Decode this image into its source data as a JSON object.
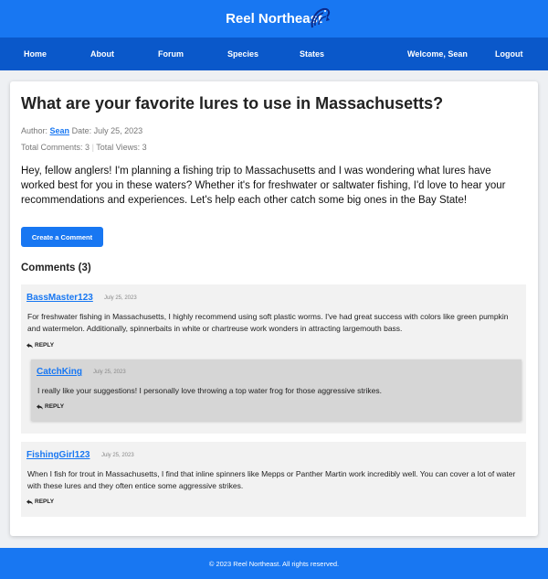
{
  "app": {
    "brand": "Reel Northeast",
    "colors": {
      "primary": "#1877f2",
      "nav": "#0a58ca",
      "comment_bg": "#f2f2f2",
      "nested_comment_bg": "#d6d6d6"
    }
  },
  "nav": {
    "items": [
      "Home",
      "About",
      "Forum",
      "Species",
      "States"
    ],
    "welcome": "Welcome, Sean",
    "logout": "Logout"
  },
  "post": {
    "title": "What are your favorite lures to use in Massachusetts?",
    "author_label": "Author:",
    "author": "Sean",
    "date_label": "Date:",
    "date": "July 25, 2023",
    "total_comments_label": "Total Comments:",
    "total_comments": "3",
    "total_views_label": "Total Views:",
    "total_views": "3",
    "body": "Hey, fellow anglers! I'm planning a fishing trip to Massachusetts and I was wondering what lures have worked best for you in these waters? Whether it's for freshwater or saltwater fishing, I'd love to hear your recommendations and experiences. Let's help each other catch some big ones in the Bay State!",
    "create_comment_label": "Create a Comment"
  },
  "comments": {
    "heading": "Comments (3)",
    "reply_label": "REPLY",
    "reply_icon": "reply-arrow-icon",
    "items": [
      {
        "user": "BassMaster123",
        "date": "July 25, 2023",
        "text": "For freshwater fishing in Massachusetts, I highly recommend using soft plastic worms. I've had great success with colors like green pumpkin and watermelon. Additionally, spinnerbaits in white or chartreuse work wonders in attracting largemouth bass.",
        "replies": [
          {
            "user": "CatchKing",
            "date": "July 25, 2023",
            "text": "I really like your suggestions! I personally love throwing a top water frog for those aggressive strikes."
          }
        ]
      },
      {
        "user": "FishingGirl123",
        "date": "July 25, 2023",
        "text": "When I fish for trout in Massachusetts, I find that inline spinners like Mepps or Panther Martin work incredibly well. You can cover a lot of water with these lures and they often entice some aggressive strikes."
      }
    ]
  },
  "footer": {
    "text": "© 2023 Reel Northeast. All rights reserved."
  }
}
